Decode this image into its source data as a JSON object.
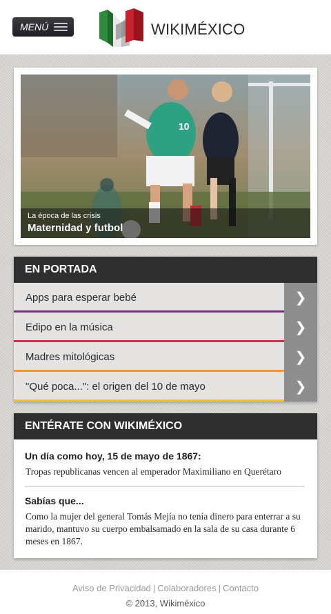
{
  "header": {
    "menu_label": "MENÚ",
    "logo_text": "WIKIMÉXICO"
  },
  "hero": {
    "kicker": "La época de las crisis",
    "title": "Maternidad y futbol",
    "player_number": "10"
  },
  "portada": {
    "title": "EN PORTADA",
    "items": [
      {
        "label": "Apps para esperar bebé",
        "accent": "#7a2f8f"
      },
      {
        "label": "Edipo en la música",
        "accent": "#d62b4f"
      },
      {
        "label": "Madres mitológicas",
        "accent": "#f0953a"
      },
      {
        "label": "\"Qué poca...\": el origen del 10 de mayo",
        "accent": "#f2c13a"
      }
    ]
  },
  "enterate": {
    "title": "ENTÉRATE CON WIKIMÉXICO",
    "today_title": "Un día como hoy, 15 de mayo de 1867:",
    "today_text": "Tropas republicanas vencen al emperador Maximiliano en Querétaro",
    "know_title": "Sabías que...",
    "know_text": "Como la mujer del general Tomás Mejía no tenía dinero para enterrar a su marido, mantuvo su cuerpo embalsamado en la sala de su casa durante 6 meses en 1867."
  },
  "footer": {
    "privacy": "Aviso de Privacidad",
    "collaborators": "Colaboradores",
    "contact": "Contacto",
    "copyright": "© 2013, Wikiméxico"
  },
  "colors": {
    "header_bg": "#ffffff",
    "section_head": "#2f2f2f",
    "arrow_box": "#8e8e8e",
    "logo_green": "#2e8b3d",
    "logo_red": "#c8202e"
  },
  "icons": [
    "menu-icon",
    "chevron-right-icon"
  ]
}
